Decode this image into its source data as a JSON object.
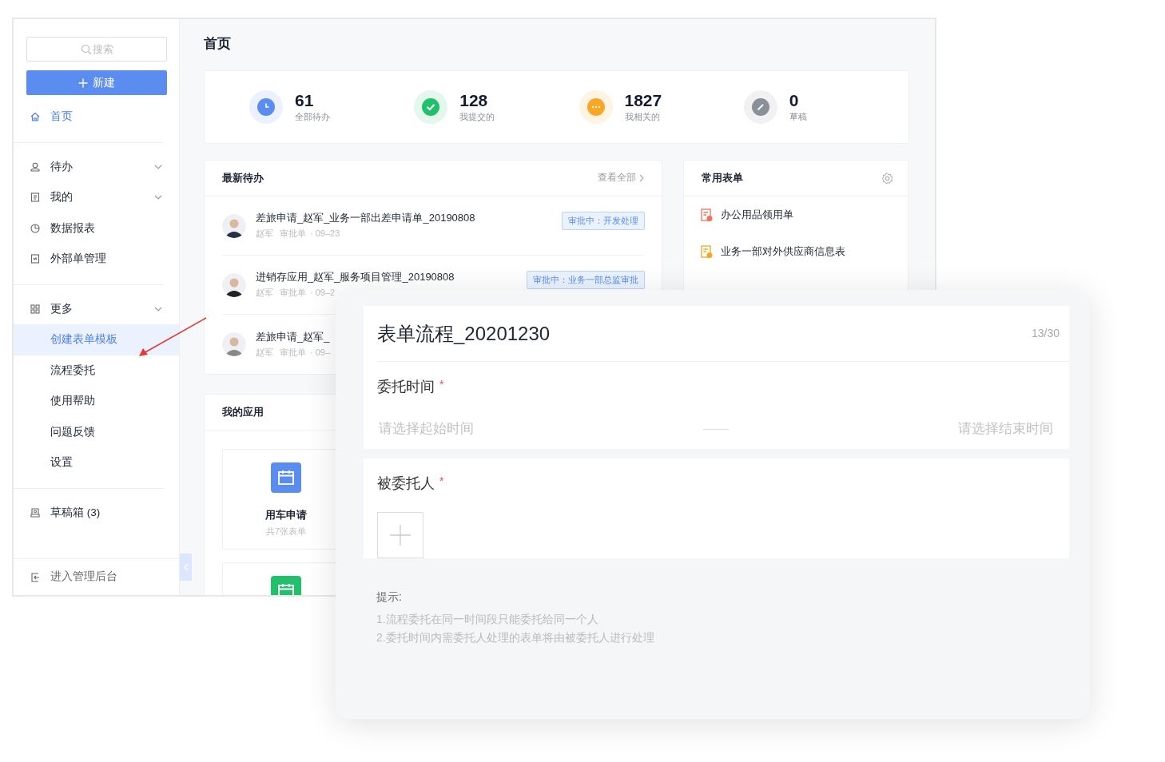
{
  "sidebar": {
    "search": {
      "placeholder": "搜索"
    },
    "new_button": "新建",
    "groups": [
      {
        "items": [
          {
            "kind": "link",
            "label": "首页",
            "selected": true
          }
        ]
      },
      {
        "items": [
          {
            "kind": "menu",
            "label": "待办",
            "selected": false
          },
          {
            "kind": "menu",
            "label": "我的",
            "selected": false
          },
          {
            "kind": "link",
            "label": "数据报表",
            "selected": false
          },
          {
            "kind": "link",
            "label": "外部单管理",
            "selected": false
          }
        ]
      },
      {
        "items": [
          {
            "kind": "menu",
            "label": "更多",
            "selected": false,
            "children": [
              {
                "label": "创建表单模板",
                "selected": true
              },
              {
                "label": "流程委托",
                "selected": false
              },
              {
                "label": "使用帮助",
                "selected": false
              },
              {
                "label": "问题反馈",
                "selected": false
              },
              {
                "label": "设置",
                "selected": false
              }
            ]
          }
        ]
      },
      {
        "items": [
          {
            "kind": "link",
            "label": "草稿箱 (3)",
            "selected": false
          }
        ]
      }
    ],
    "footer": "进入管理后台"
  },
  "page_title": "首页",
  "stats": [
    {
      "value": "61",
      "label": "全部待办",
      "color": "#5b8cf0"
    },
    {
      "value": "128",
      "label": "我提交的",
      "color": "#22c06b"
    },
    {
      "value": "1827",
      "label": "我相关的",
      "color": "#f8a623"
    },
    {
      "value": "0",
      "label": "草稿",
      "color": "#8a8f99"
    }
  ],
  "todos": {
    "title": "最新待办",
    "view_all": "查看全部",
    "items": [
      {
        "title": "差旅申请_赵军_业务一部出差申请单_20190808",
        "author": "赵军",
        "type": "审批单",
        "date": "· 09–23",
        "status": "审批中：开发处理"
      },
      {
        "title": "进销存应用_赵军_服务项目管理_20190808",
        "author": "赵军",
        "type": "审批单",
        "date": "· 09–2",
        "status": "审批中：业务一部总监审批"
      },
      {
        "title": "差旅申请_赵军_",
        "author": "赵军",
        "type": "审批单",
        "date": "· 09–"
      }
    ]
  },
  "forms": {
    "title": "常用表单",
    "items": [
      {
        "label": "办公用品领用单",
        "color": "#ef7358"
      },
      {
        "label": "业务一部对外供应商信息表",
        "color": "#f5a623"
      }
    ]
  },
  "apps": {
    "title": "我的应用",
    "items": [
      {
        "name": "用车申请",
        "count": "共7张表单",
        "color": "#5b8cf0"
      },
      {
        "color": "#22c06b"
      }
    ]
  },
  "dialog": {
    "title": "表单流程_20201230",
    "counter": "13/30",
    "fields": [
      {
        "kind": "date_range",
        "label": "委托时间",
        "required": true,
        "required_mark": "*",
        "start_placeholder": "请选择起始时间",
        "end_placeholder": "请选择结束时间"
      },
      {
        "kind": "person",
        "label": "被委托人",
        "required": true,
        "required_mark": "*"
      }
    ],
    "tips": {
      "title": "提示:",
      "lines": [
        "1.流程委托在同一时间段只能委托给同一个人",
        "2.委托时间内需委托人处理的表单将由被委托人进行处理"
      ]
    }
  }
}
